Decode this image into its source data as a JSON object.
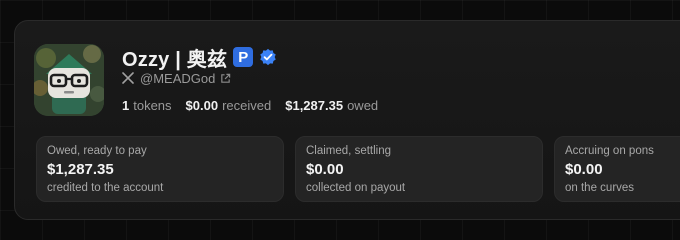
{
  "profile": {
    "name": "Ozzy | 奥兹",
    "badge_letter": "P",
    "handle": "@MEADGod",
    "avatar_icon": "cartoon-character-with-glasses-avatar",
    "badge_icon": "p-square-icon",
    "verified_icon": "verified-checkmark-icon",
    "x_icon": "x-logo-icon",
    "external_icon": "external-link-icon"
  },
  "stats": [
    {
      "value": "1",
      "label": "tokens"
    },
    {
      "value": "$0.00",
      "label": "received"
    },
    {
      "value": "$1,287.35",
      "label": "owed"
    }
  ],
  "tiles": [
    {
      "label": "Owed, ready to pay",
      "amount": "$1,287.35",
      "sub": "credited to the account"
    },
    {
      "label": "Claimed, settling",
      "amount": "$0.00",
      "sub": "collected on payout"
    },
    {
      "label": "Accruing on pons",
      "amount": "$0.00",
      "sub": "on the curves"
    }
  ],
  "colors": {
    "background": "#0b0b0b",
    "card": "#1a1a1a",
    "tile": "#242424",
    "accent_blue": "#2f6de0",
    "verified_blue": "#3b82f6"
  }
}
